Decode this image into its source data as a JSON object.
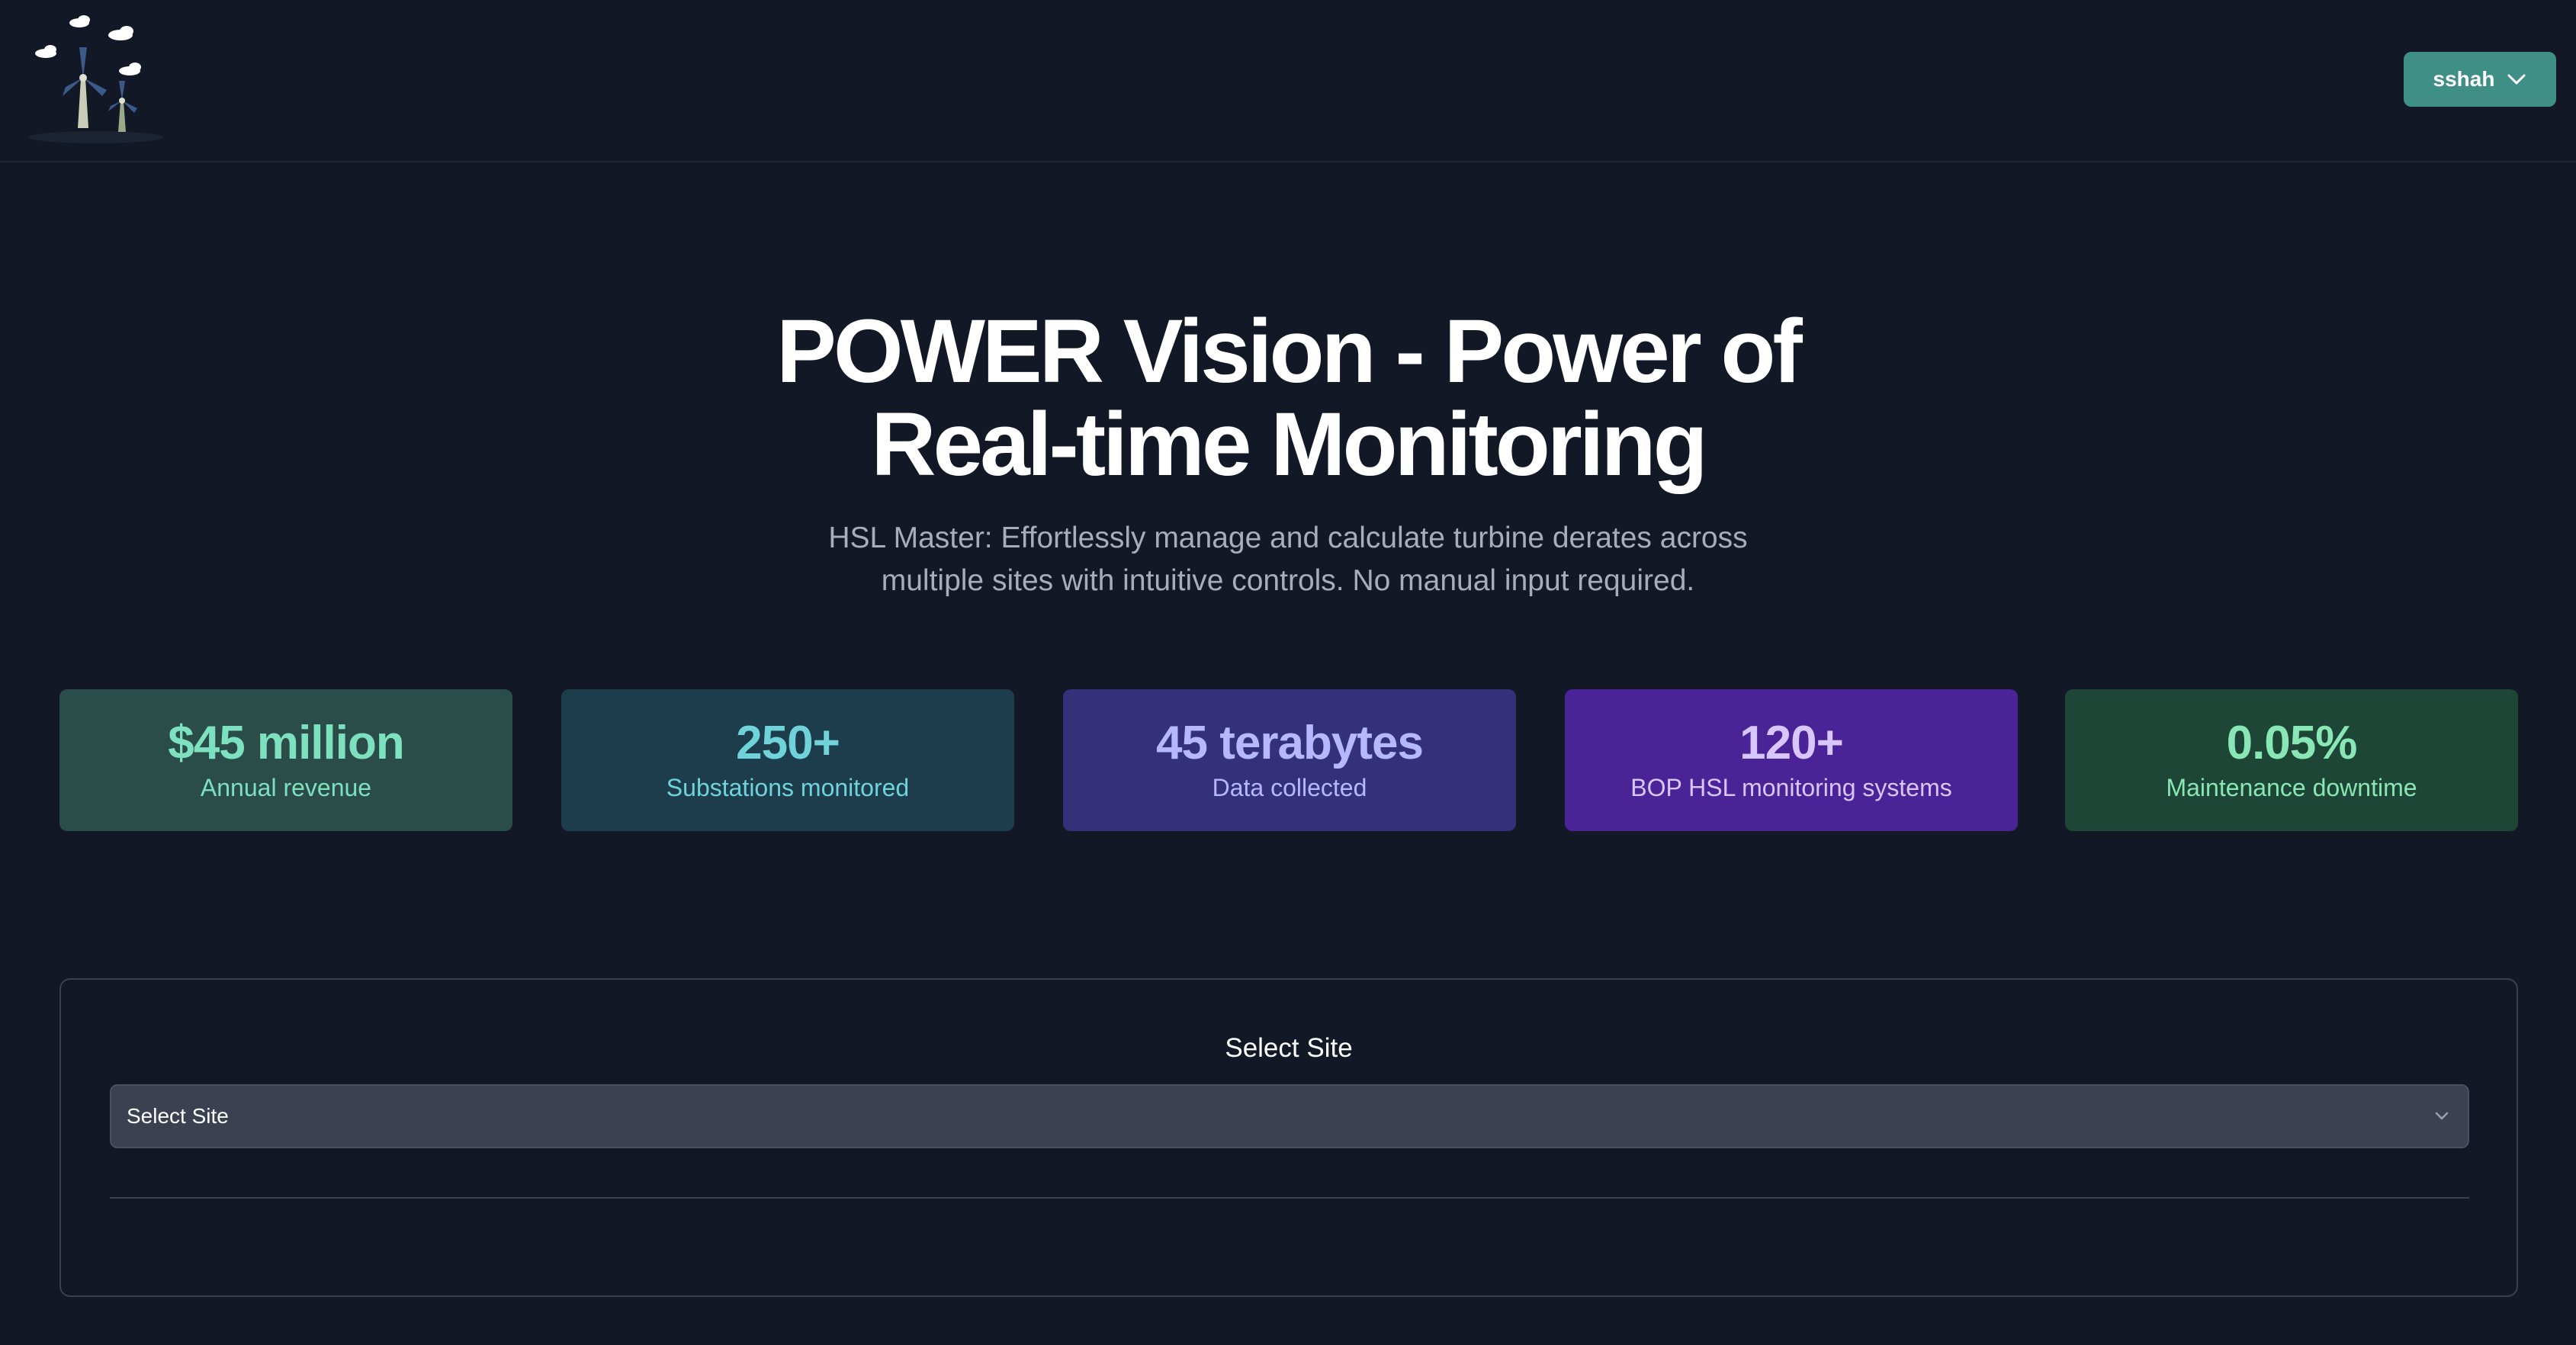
{
  "header": {
    "user_name": "sshah"
  },
  "hero": {
    "title_line1": "POWER Vision - Power of",
    "title_line2": "Real-time Monitoring",
    "subtitle_line1": "HSL Master: Effortlessly manage and calculate turbine derates across",
    "subtitle_line2": "multiple sites with intuitive controls. No manual input required."
  },
  "stats": [
    {
      "value": "$45 million",
      "label": "Annual revenue",
      "bg": "#2a4d4a",
      "color": "#7de0bf",
      "label_color": "#7de0bf"
    },
    {
      "value": "250+",
      "label": "Substations monitored",
      "bg": "#1d3c4c",
      "color": "#6fd3d9",
      "label_color": "#6fd3d9"
    },
    {
      "value": "45 terabytes",
      "label": "Data collected",
      "bg": "#34317a",
      "color": "#b6b8ff",
      "label_color": "#b6b8ff"
    },
    {
      "value": "120+",
      "label": "BOP HSL monitoring systems",
      "bg": "#4a2496",
      "color": "#d7c6ff",
      "label_color": "#d7c6ff"
    },
    {
      "value": "0.05%",
      "label": "Maintenance downtime",
      "bg": "#1e4636",
      "color": "#89e6b5",
      "label_color": "#89e6b5"
    }
  ],
  "site_select": {
    "title": "Select Site",
    "selected_value": "Select Site"
  },
  "icons": {
    "logo": "wind-turbine-logo-icon",
    "user_menu": "chevron-down-icon",
    "select": "chevron-down-icon"
  },
  "colors": {
    "background": "#121826",
    "accent": "#3f8f86",
    "card_border": "#394050",
    "select_bg": "#3b4150"
  }
}
